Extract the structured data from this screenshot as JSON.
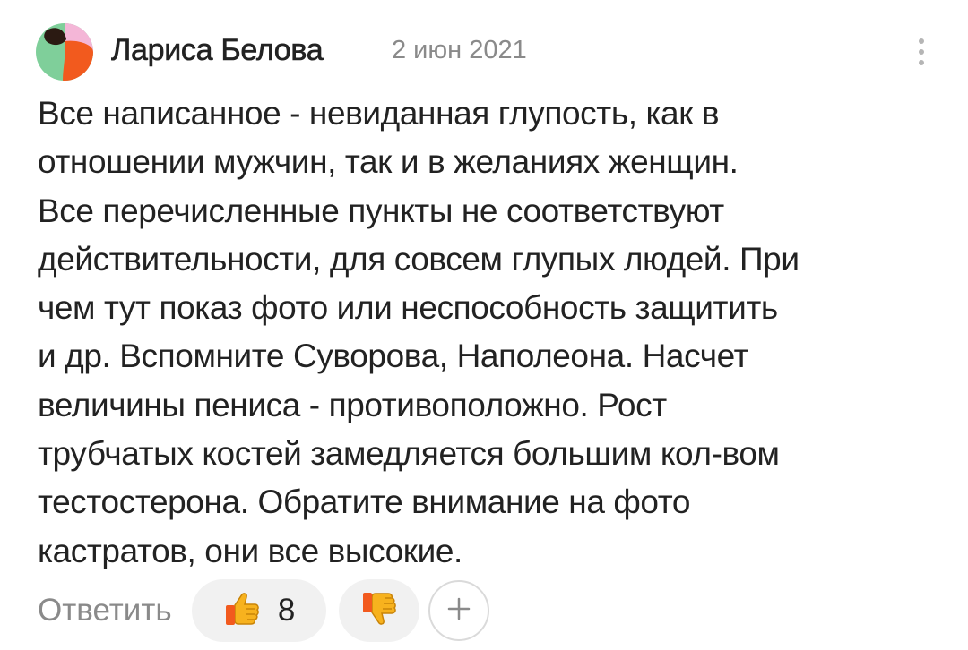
{
  "comment": {
    "author": "Лариса Белова",
    "date": "2 июн 2021",
    "lines": [
      "Все написанное - невиданная глупость, как в",
      "отношении мужчин, так и в желаниях женщин.",
      "Все перечисленные пункты не соответствуют",
      "действительности, для совсем глупых людей. При",
      "чем тут показ фото или неспособность защитить",
      "и др. Вспомните Суворова, Наполеона. Насчет",
      "величины пениса - противоположно. Рост",
      "трубчатых костей замедляется большим кол-вом",
      "тестостерона. Обратите внимание на фото",
      "кастратов, они все высокие."
    ]
  },
  "actions": {
    "reply_label": "Ответить",
    "like_count": "8",
    "like_icon": "thumbs-up-emoji",
    "dislike_icon": "thumbs-down-emoji",
    "add_reaction_icon": "plus-icon"
  },
  "colors": {
    "avatar_green": "#7fcf9a",
    "avatar_orange": "#f25a1e",
    "avatar_pink": "#f4b6d7",
    "avatar_dark": "#2b1a12",
    "meta_gray": "#8a8a8a",
    "pill_bg": "#f1f1f1",
    "thumb_yellow": "#f7b21e"
  }
}
